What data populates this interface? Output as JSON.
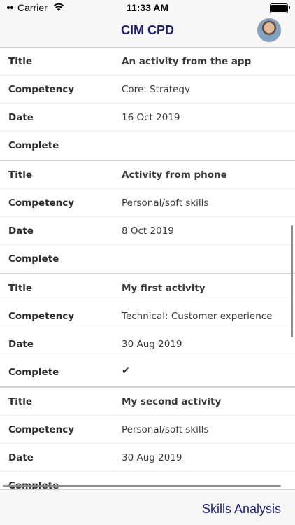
{
  "status_bar": {
    "carrier": "Carrier",
    "time": "11:33 AM"
  },
  "nav": {
    "title": "CIM CPD"
  },
  "labels": {
    "title": "Title",
    "competency": "Competency",
    "date": "Date",
    "complete": "Complete"
  },
  "activities": [
    {
      "title": "An activity from the app",
      "competency": "Core: Strategy",
      "date": "16 Oct 2019",
      "complete": false
    },
    {
      "title": "Activity from phone",
      "competency": "Personal/soft skills",
      "date": "8 Oct 2019",
      "complete": false
    },
    {
      "title": "My first activity",
      "competency": "Technical: Customer experience",
      "date": "30 Aug 2019",
      "complete": true
    },
    {
      "title": "My second activity",
      "competency": "Personal/soft skills",
      "date": "30 Aug 2019",
      "complete": false
    }
  ],
  "icons": {
    "complete_check": "✔",
    "wifi": "wifi-icon",
    "battery": "battery-icon",
    "avatar": "user-avatar"
  },
  "tab_bar": {
    "skills_analysis": "Skills Analysis"
  },
  "colors": {
    "accent": "#1b1e6f",
    "bar_background": "#f7f7f7"
  }
}
